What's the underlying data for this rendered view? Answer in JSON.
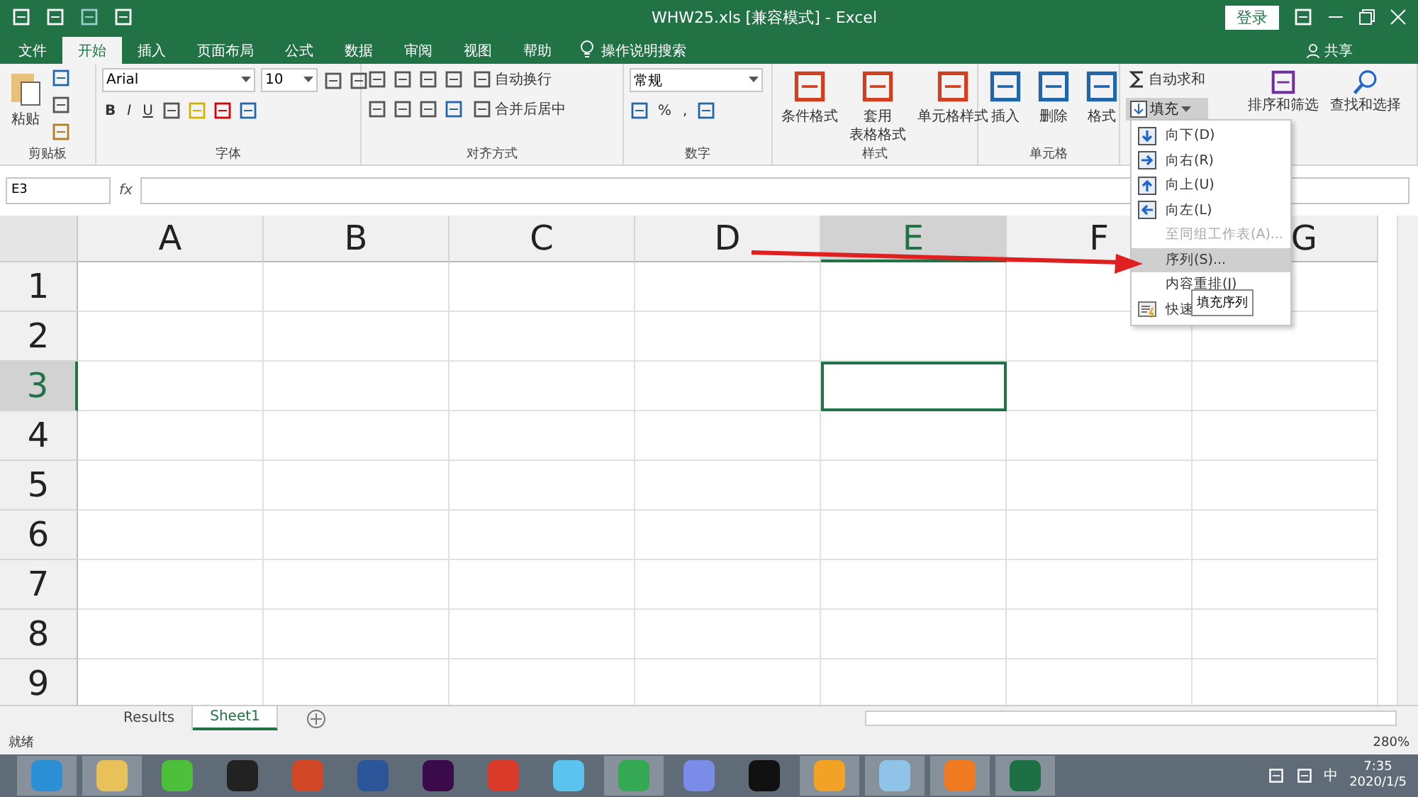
{
  "title_bar": {
    "title": "WHW25.xls  [兼容模式]  -  Excel",
    "login": "登录"
  },
  "menu_tabs": [
    {
      "label": "文件",
      "selected": false
    },
    {
      "label": "开始",
      "selected": true
    },
    {
      "label": "插入",
      "selected": false
    },
    {
      "label": "页面布局",
      "selected": false
    },
    {
      "label": "公式",
      "selected": false
    },
    {
      "label": "数据",
      "selected": false
    },
    {
      "label": "审阅",
      "selected": false
    },
    {
      "label": "视图",
      "selected": false
    },
    {
      "label": "帮助",
      "selected": false
    }
  ],
  "tell_me": "操作说明搜索",
  "share": "共享",
  "ribbon": {
    "clipboard": {
      "paste": "粘贴",
      "label": "剪贴板"
    },
    "font": {
      "font_name": "Arial",
      "font_size": "10",
      "style_buttons": [
        "B",
        "I",
        "U"
      ],
      "label": "字体"
    },
    "alignment": {
      "wrap": "自动换行",
      "merge": "合并后居中",
      "label": "对齐方式"
    },
    "number": {
      "format": "常规",
      "percent": "%",
      "comma": ",",
      "label": "数字"
    },
    "styles": {
      "buttons": [
        {
          "lines": [
            "条件格式"
          ]
        },
        {
          "lines": [
            "套用",
            "表格格式"
          ]
        },
        {
          "lines": [
            "单元格样式"
          ]
        }
      ],
      "label": "样式"
    },
    "cells": {
      "buttons": [
        "插入",
        "删除",
        "格式"
      ],
      "label": "单元格"
    },
    "editing": {
      "autosum": "自动求和",
      "fill": "填充",
      "sort": "排序和筛选",
      "find": "查找和选择"
    }
  },
  "formula_bar": {
    "name_box": "E3",
    "fx": "fx"
  },
  "columns": [
    {
      "label": "A",
      "selected": false
    },
    {
      "label": "B",
      "selected": false
    },
    {
      "label": "C",
      "selected": false
    },
    {
      "label": "D",
      "selected": false
    },
    {
      "label": "E",
      "selected": true
    },
    {
      "label": "F",
      "selected": false
    },
    {
      "label": "G",
      "selected": false
    }
  ],
  "rows": [
    {
      "label": "1",
      "selected": false
    },
    {
      "label": "2",
      "selected": false
    },
    {
      "label": "3",
      "selected": true
    },
    {
      "label": "4",
      "selected": false
    },
    {
      "label": "5",
      "selected": false
    },
    {
      "label": "6",
      "selected": false
    },
    {
      "label": "7",
      "selected": false
    },
    {
      "label": "8",
      "selected": false
    },
    {
      "label": "9",
      "selected": false
    }
  ],
  "fill_menu": [
    {
      "label": "向下(D)",
      "kind": "down",
      "disabled": false,
      "selected": false
    },
    {
      "label": "向右(R)",
      "kind": "right",
      "disabled": false,
      "selected": false
    },
    {
      "label": "向上(U)",
      "kind": "up",
      "disabled": false,
      "selected": false
    },
    {
      "label": "向左(L)",
      "kind": "left",
      "disabled": false,
      "selected": false
    },
    {
      "label": "至同组工作表(A)...",
      "kind": "plain",
      "disabled": true,
      "selected": false
    },
    {
      "label": "序列(S)...",
      "kind": "plain",
      "disabled": false,
      "selected": true
    },
    {
      "label": "内容重排(J)",
      "kind": "plain",
      "disabled": false,
      "selected": false
    },
    {
      "label": "快速",
      "kind": "flash",
      "disabled": false,
      "selected": false
    }
  ],
  "tooltip": "填充序列",
  "sheet_tabs": [
    {
      "label": "Results",
      "selected": false
    },
    {
      "label": "Sheet1",
      "selected": true
    }
  ],
  "status_bar": {
    "status": "就绪",
    "zoom": "280%"
  },
  "taskbar": {
    "apps": [
      {
        "color": "#2b8fd6",
        "active": true
      },
      {
        "color": "#e8c15a",
        "active": true
      },
      {
        "color": "#4cbf3b",
        "active": false
      },
      {
        "color": "#222222",
        "active": false
      },
      {
        "color": "#d24726",
        "active": false
      },
      {
        "color": "#2b579a",
        "active": false
      },
      {
        "color": "#3a0a4a",
        "active": false
      },
      {
        "color": "#d93a2a",
        "active": false
      },
      {
        "color": "#5bc4ee",
        "active": false
      },
      {
        "color": "#34a853",
        "active": true
      },
      {
        "color": "#7b8ce8",
        "active": false
      },
      {
        "color": "#111111",
        "active": false
      },
      {
        "color": "#f2a325",
        "active": true
      },
      {
        "color": "#8fc4e8",
        "active": true
      },
      {
        "color": "#f07a20",
        "active": true
      },
      {
        "color": "#1d7044",
        "active": true
      }
    ],
    "ime": "中",
    "time": "7:35",
    "date": "2020/1/5"
  }
}
